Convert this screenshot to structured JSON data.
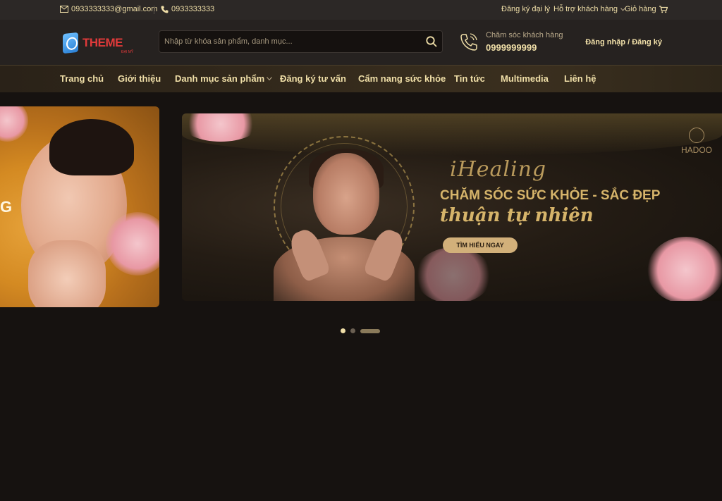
{
  "topbar": {
    "email": "0933333333@gmail.com",
    "phone": "0933333333",
    "links": [
      "Đăng ký đại lý",
      "Hỗ trợ khách hàng",
      "Giỏ hàng"
    ]
  },
  "header": {
    "logo_text": "THEME",
    "logo_sub": "ĐẠI MỸ",
    "search_placeholder": "Nhập từ khóa sản phẩm, danh mục...",
    "hotline_label": "Chăm sóc khách hàng",
    "hotline_number": "0999999999",
    "auth": "Đăng nhập / Đăng ký"
  },
  "nav": {
    "items": [
      "Trang chủ",
      "Giới thiệu",
      "Danh mục sản phẩm",
      "Đăng ký tư vấn",
      "Cẩm nang sức khỏe",
      "Tin tức",
      "Multimedia",
      "Liên hệ"
    ]
  },
  "banner": {
    "script": "iHealing",
    "title": "CHĂM SÓC SỨC KHỎE - SẮC ĐẸP",
    "subtitle": "thuận tự nhiên",
    "button": "TÌM HIỂU NGAY",
    "brand": "HADOO"
  },
  "slider": {
    "left_caption": "G",
    "dots": 3,
    "active_index": 0
  },
  "colors": {
    "accent": "#f0dfa8",
    "background": "#161210",
    "banner_gold": "#d6b46a"
  }
}
